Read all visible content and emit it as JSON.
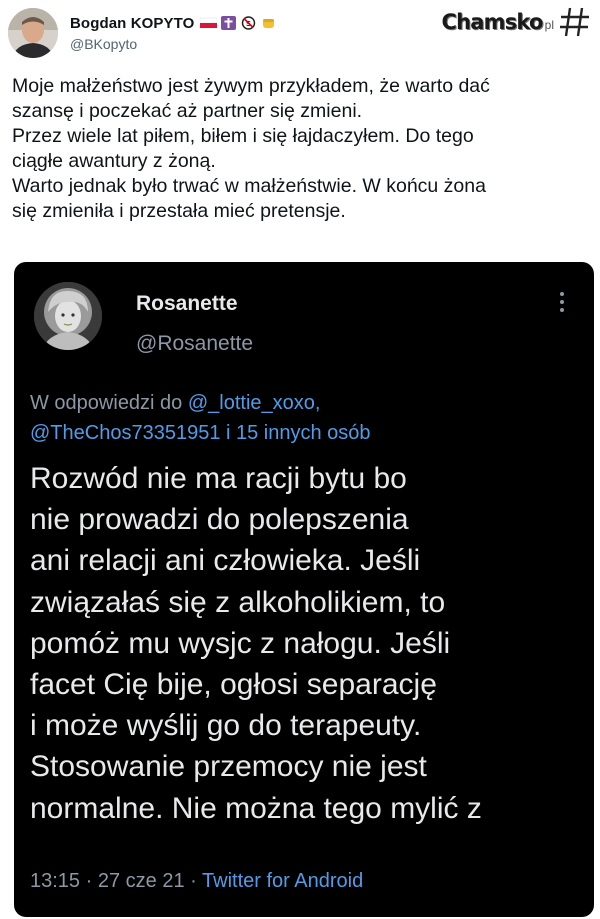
{
  "tweet": {
    "display_name": "Bogdan KOPYTO",
    "handle": "@BKopyto",
    "badges": [
      "poland-flag-icon",
      "cross-icon",
      "no-symbol-icon",
      "fist-icon"
    ],
    "text_lines": [
      "Moje małżeństwo jest żywym przykładem, że warto dać",
      "szansę i poczekać aż partner się zmieni.",
      "Przez wiele lat piłem, biłem i się łajdaczyłem. Do tego",
      "ciągłe awantury z żoną.",
      "Warto jednak było trwać w małżeństwie. W końcu żona",
      "się zmieniła i przestała mieć pretensje."
    ]
  },
  "watermark": {
    "text": "Chamsko",
    "suffix": "pl"
  },
  "quoted": {
    "display_name": "Rosanette",
    "handle": "@Rosanette",
    "reply_prefix": "W odpowiedzi do",
    "mention_1": "@_lottie_xoxo,",
    "mention_2": "@TheChos73351951 i 15 innych osób",
    "body_lines": [
      "Rozwód nie ma racji bytu bo",
      "nie prowadzi do polepszenia",
      "ani relacji ani człowieka. Jeśli",
      "związałaś się z alkoholikiem, to",
      "pomóż mu wysjc z nałogu. Jeśli",
      "facet Cię bije, ogłosi separację",
      "i może wyślij go do terapeuty.",
      "Stosowanie przemocy nie jest",
      "normalne. Nie można tego mylić z"
    ],
    "time": "13:15",
    "date": "27 cze 21",
    "separator": "·",
    "source": "Twitter for Android"
  },
  "colors": {
    "link": "#4f9de8",
    "card_bg": "#000000",
    "muted": "#8b98a5"
  }
}
